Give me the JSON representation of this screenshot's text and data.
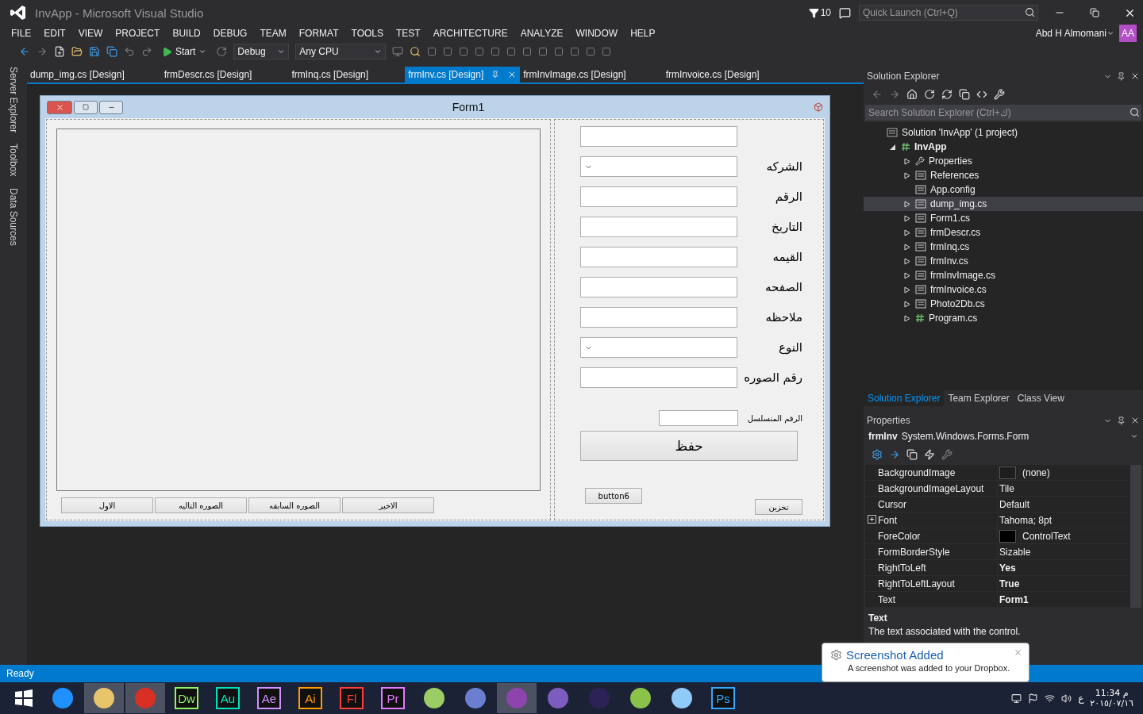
{
  "window": {
    "title": "InvApp - Microsoft Visual Studio",
    "notifications": "10",
    "quick_launch": {
      "placeholder": "Quick Launch (Ctrl+Q)"
    },
    "user": "Abd H Almomani",
    "avatar": "AA"
  },
  "menu": [
    "FILE",
    "EDIT",
    "VIEW",
    "PROJECT",
    "BUILD",
    "DEBUG",
    "TEAM",
    "FORMAT",
    "TOOLS",
    "TEST",
    "ARCHITECTURE",
    "ANALYZE",
    "WINDOW",
    "HELP"
  ],
  "toolbar": {
    "start": "Start",
    "configuration": "Debug",
    "platform": "Any CPU"
  },
  "side_tabs": [
    "Server Explorer",
    "Toolbox",
    "Data Sources"
  ],
  "document_tabs": [
    {
      "label": "dump_img.cs [Design]",
      "selected": false
    },
    {
      "label": "frmDescr.cs [Design]",
      "selected": false
    },
    {
      "label": "frmInq.cs [Design]",
      "selected": false
    },
    {
      "label": "frmInv.cs [Design]",
      "selected": true
    },
    {
      "label": "frmInvImage.cs [Design]",
      "selected": false
    },
    {
      "label": "frmInvoice.cs [Design]",
      "selected": false
    }
  ],
  "form": {
    "title": "Form1",
    "nav_buttons": [
      "الاخير",
      "الصوره السابقه",
      "الصوره التاليه",
      "الاول"
    ],
    "fields": [
      {
        "kind": "text"
      },
      {
        "kind": "combo",
        "label": "الشركه"
      },
      {
        "kind": "text",
        "label": "الرقم"
      },
      {
        "kind": "text",
        "label": "التاريخ"
      },
      {
        "kind": "text",
        "label": "القيمه"
      },
      {
        "kind": "text",
        "label": "الصفحه"
      },
      {
        "kind": "text",
        "label": "ملاحظه"
      },
      {
        "kind": "combo",
        "label": "النوع"
      },
      {
        "kind": "text",
        "label": "رقم الصوره"
      }
    ],
    "serial_label": "الرقم المتسلسل",
    "save_button": "حفظ",
    "extra_button": "button6",
    "store_button": "تخزين"
  },
  "solution_explorer": {
    "title": "Solution Explorer",
    "search": {
      "placeholder": "Search Solution Explorer (Ctrl+ك)"
    },
    "tree": [
      {
        "label": "Solution 'InvApp' (1 project)",
        "kind": "solution",
        "selected": false,
        "children": [
          {
            "label": "InvApp",
            "kind": "project",
            "selected": false,
            "expanded": true,
            "children": [
              {
                "label": "Properties",
                "kind": "wrench",
                "selected": false,
                "expanded": false
              },
              {
                "label": "References",
                "kind": "references",
                "selected": false,
                "expanded": false
              },
              {
                "label": "App.config",
                "kind": "config",
                "selected": false
              },
              {
                "label": "dump_img.cs",
                "kind": "form",
                "selected": true,
                "expanded": false
              },
              {
                "label": "Form1.cs",
                "kind": "form",
                "selected": false,
                "expanded": false
              },
              {
                "label": "frmDescr.cs",
                "kind": "form",
                "selected": false,
                "expanded": false
              },
              {
                "label": "frmInq.cs",
                "kind": "form",
                "selected": false,
                "expanded": false
              },
              {
                "label": "frmInv.cs",
                "kind": "form",
                "selected": false,
                "expanded": false
              },
              {
                "label": "frmInvImage.cs",
                "kind": "form",
                "selected": false,
                "expanded": false
              },
              {
                "label": "frmInvoice.cs",
                "kind": "form",
                "selected": false,
                "expanded": false
              },
              {
                "label": "Photo2Db.cs",
                "kind": "form",
                "selected": false,
                "expanded": false
              },
              {
                "label": "Program.cs",
                "kind": "csharp",
                "selected": false,
                "expanded": false
              }
            ]
          }
        ]
      }
    ]
  },
  "panel_tabs": [
    {
      "label": "Solution Explorer",
      "selected": true
    },
    {
      "label": "Team Explorer",
      "selected": false
    },
    {
      "label": "Class View",
      "selected": false
    }
  ],
  "properties": {
    "title": "Properties",
    "object_name": "frmInv",
    "object_type": "System.Windows.Forms.Form",
    "rows": [
      {
        "name": "BackgroundImage",
        "value": "(none)",
        "color": "#1e1e1e",
        "changed": false
      },
      {
        "name": "BackgroundImageLayout",
        "value": "Tile",
        "changed": false
      },
      {
        "name": "Cursor",
        "value": "Default",
        "changed": false
      },
      {
        "name": "Font",
        "value": "Tahoma; 8pt",
        "changed": false,
        "expanded": false
      },
      {
        "name": "ForeColor",
        "value": "ControlText",
        "color": "#000000",
        "changed": false
      },
      {
        "name": "FormBorderStyle",
        "value": "Sizable",
        "changed": false
      },
      {
        "name": "RightToLeft",
        "value": "Yes",
        "changed": true
      },
      {
        "name": "RightToLeftLayout",
        "value": "True",
        "changed": true
      },
      {
        "name": "Text",
        "value": "Form1",
        "changed": true
      }
    ],
    "description_title": "Text",
    "description": "The text associated with the control."
  },
  "status_bar": {
    "text": "Ready"
  },
  "notification": {
    "title": "Screenshot Added",
    "message": "A screenshot was added to your Dropbox."
  },
  "taskbar": {
    "apps": [
      {
        "kind": "glyph",
        "color": "#1e90ff",
        "active": false
      },
      {
        "kind": "glyph",
        "color": "#e8c46a",
        "active": true
      },
      {
        "kind": "glyph",
        "color": "#d93025",
        "active": true
      },
      {
        "kind": "letters",
        "label": "Dw",
        "color": "#8ef45f",
        "active": false
      },
      {
        "kind": "letters",
        "label": "Au",
        "color": "#00e4bb",
        "active": false
      },
      {
        "kind": "letters",
        "label": "Ae",
        "color": "#d291ff",
        "active": false
      },
      {
        "kind": "letters",
        "label": "Ai",
        "color": "#ff9a00",
        "active": false
      },
      {
        "kind": "letters",
        "label": "Fl",
        "color": "#ff3d3d",
        "active": false
      },
      {
        "kind": "letters",
        "label": "Pr",
        "color": "#e579ff",
        "active": false
      },
      {
        "kind": "glyph",
        "color": "#9ccc65",
        "active": false
      },
      {
        "kind": "glyph",
        "color": "#6a7fd0",
        "active": false
      },
      {
        "kind": "glyph",
        "color": "#8e44ad",
        "active": true
      },
      {
        "kind": "glyph",
        "color": "#7c5cbf",
        "active": false
      },
      {
        "kind": "glyph",
        "color": "#2c2255",
        "active": false
      },
      {
        "kind": "glyph",
        "color": "#8bc34a",
        "active": false
      },
      {
        "kind": "glyph",
        "color": "#90caf9",
        "active": false
      },
      {
        "kind": "letters",
        "label": "Ps",
        "color": "#31a8ff",
        "active": false
      }
    ],
    "tray": {
      "language": "ع",
      "time": "11:34 م",
      "date": "٢٠١٥/٠٧/١٦"
    }
  }
}
